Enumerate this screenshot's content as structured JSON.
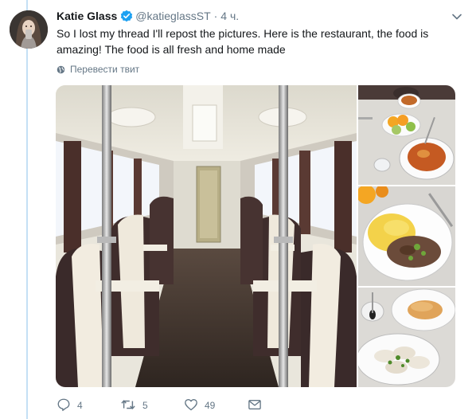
{
  "tweet": {
    "display_name": "Katie Glass",
    "handle": "@katieglassST",
    "separator": "·",
    "time": "4 ч.",
    "text": "So I lost my thread I'll repost the pictures. Here is the restaurant, the food is amazing! The food is all fresh  and home made",
    "translate_label": "Перевести твит",
    "avatar_alt": "Katie Glass avatar"
  },
  "icons": {
    "verified": "verified-badge-icon",
    "caret": "chevron-down-icon",
    "translate": "globe-icon",
    "reply": "reply-icon",
    "retweet": "retweet-icon",
    "like": "heart-icon",
    "dm": "direct-message-icon"
  },
  "media": {
    "main": "restaurant-car-interior",
    "thumbs": [
      "soup-and-salad",
      "mashed-potatoes-with-stroganoff",
      "dumplings-and-pastry"
    ]
  },
  "actions": {
    "reply_count": "4",
    "retweet_count": "5",
    "like_count": "49"
  },
  "colors": {
    "accent": "#1da1f2",
    "thread_line": "#c4e0f5",
    "muted": "#657786"
  }
}
